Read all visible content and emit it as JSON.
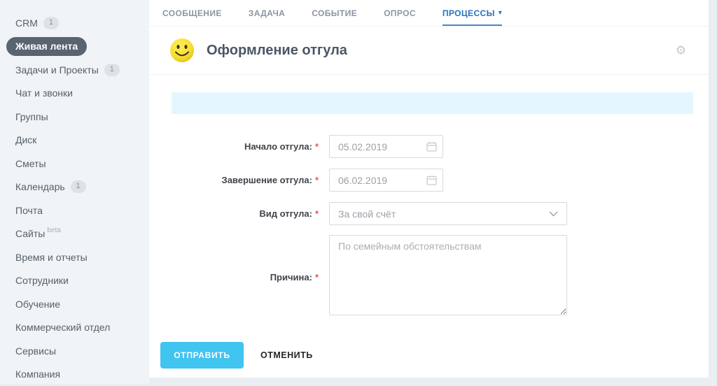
{
  "colors": {
    "accent_blue": "#2272c3",
    "tab_underline": "#4a86c8",
    "submit_button": "#40c4f0",
    "banner_bg": "#e4f7fe",
    "sidebar_bg": "#f0f4f6",
    "page_bg": "#e9eef2",
    "active_item_bg": "#5a6370",
    "required_red": "#f05555"
  },
  "icons": {
    "gear": "⚙",
    "caret_down": "▾",
    "smiley": "smiley-face",
    "calendar": "calendar",
    "chevron_down": "chevron-down"
  },
  "sidebar": {
    "items": [
      {
        "id": "crm",
        "label": "CRM",
        "badge": "1"
      },
      {
        "id": "live-feed",
        "label": "Живая лента",
        "active": true
      },
      {
        "id": "tasks-projects",
        "label": "Задачи и Проекты",
        "badge": "1"
      },
      {
        "id": "chat-calls",
        "label": "Чат и звонки"
      },
      {
        "id": "groups",
        "label": "Группы"
      },
      {
        "id": "drive",
        "label": "Диск"
      },
      {
        "id": "estimates",
        "label": "Сметы"
      },
      {
        "id": "calendar",
        "label": "Календарь",
        "badge": "1"
      },
      {
        "id": "mail",
        "label": "Почта"
      },
      {
        "id": "sites",
        "label": "Сайты",
        "suffix": "beta"
      },
      {
        "id": "time-reports",
        "label": "Время и отчеты"
      },
      {
        "id": "employees",
        "label": "Сотрудники"
      },
      {
        "id": "training",
        "label": "Обучение"
      },
      {
        "id": "commercial-dept",
        "label": "Коммерческий отдел"
      },
      {
        "id": "services",
        "label": "Сервисы"
      },
      {
        "id": "company",
        "label": "Компания"
      }
    ]
  },
  "tabs": {
    "items": [
      {
        "id": "message",
        "label": "СООБЩЕНИЕ"
      },
      {
        "id": "task",
        "label": "ЗАДАЧА"
      },
      {
        "id": "event",
        "label": "СОБЫТИЕ"
      },
      {
        "id": "poll",
        "label": "ОПРОС"
      },
      {
        "id": "processes",
        "label": "ПРОЦЕССЫ",
        "active": true,
        "caret": "▾"
      }
    ]
  },
  "header": {
    "title": "Оформление отгула"
  },
  "form": {
    "required_mark": "*",
    "fields": [
      {
        "label": "Начало отгула:",
        "type": "date",
        "value": "05.02.2019"
      },
      {
        "label": "Завершение отгула:",
        "type": "date",
        "value": "06.02.2019"
      },
      {
        "label": "Вид отгула:",
        "type": "select",
        "value": "За свой счёт"
      },
      {
        "label": "Причина:",
        "type": "textarea",
        "placeholder": "По семейным обстоятельствам"
      }
    ],
    "submit_label": "ОТПРАВИТЬ",
    "cancel_label": "ОТМЕНИТЬ"
  }
}
